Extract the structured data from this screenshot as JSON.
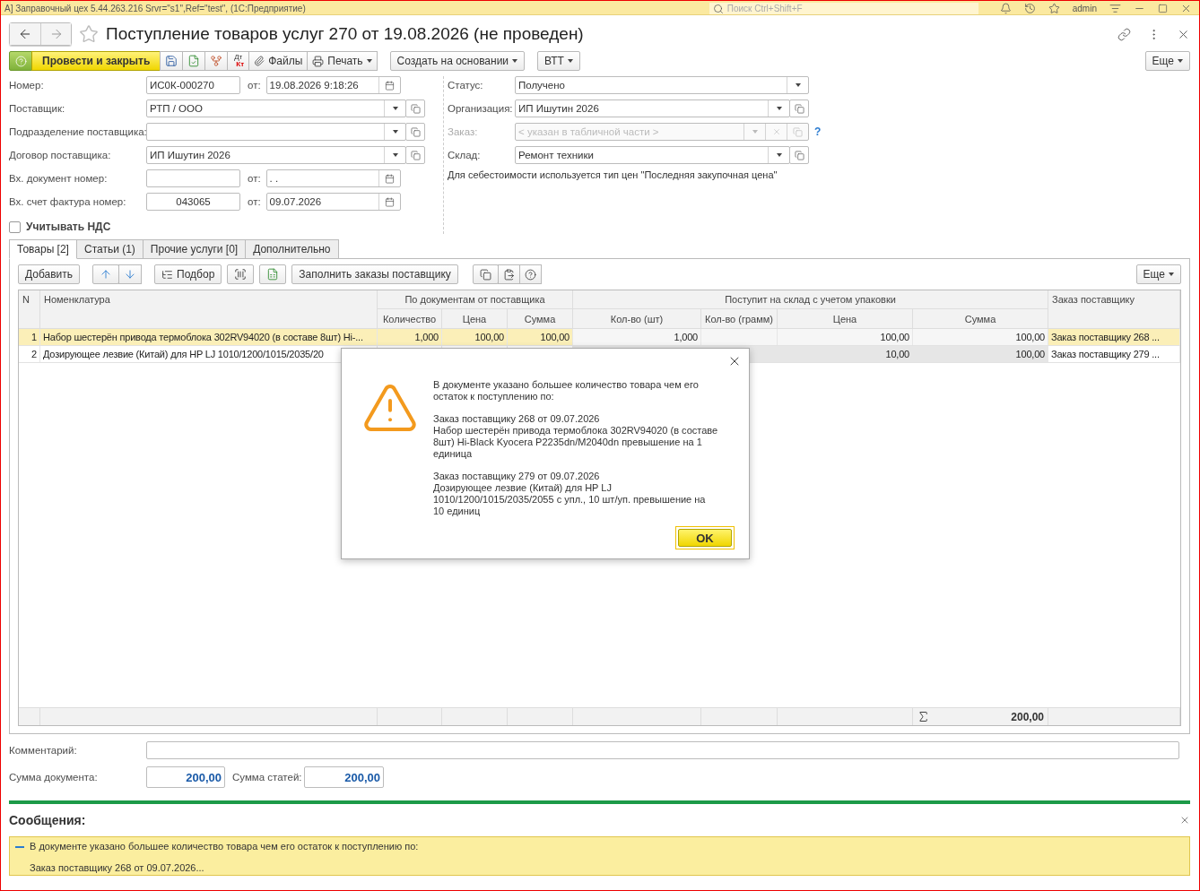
{
  "app_bar": {
    "title": "А] Заправочный цех 5.44.263.216 Srvr=\"s1\",Ref=\"test\", (1С:Предприятие)",
    "search_placeholder": "Поиск Ctrl+Shift+F",
    "user": "admin"
  },
  "form": {
    "title": "Поступление товаров услуг 270 от 19.08.2026 (не проведен)"
  },
  "toolbar": {
    "primary": "Провести и закрыть",
    "ledger_marks": [
      "Дт",
      "Кт"
    ],
    "files": "Файлы",
    "print": "Печать",
    "create_based": "Создать на основании",
    "vtt": "ВТТ",
    "more": "Еще"
  },
  "left_fields": [
    {
      "kind": "number_date",
      "label": "Номер:",
      "value": "ИС0К-000270",
      "date_label": "от:",
      "date": "19.08.2026  9:18:26"
    },
    {
      "kind": "select",
      "label": "Поставщик:",
      "value": "РТП / ООО"
    },
    {
      "kind": "select",
      "label": "Подразделение поставщика:"
    },
    {
      "kind": "select",
      "label": "Договор поставщика:",
      "value": "ИП Ишутин 2026"
    },
    {
      "kind": "number_date",
      "label": "Вх. документ номер:",
      "date_label": "от:",
      "date": " .  ."
    },
    {
      "kind": "number_date",
      "label": "Вх. счет фактура номер:",
      "value": "043065",
      "centered": true,
      "date_label": "от:",
      "date": "09.07.2026"
    }
  ],
  "vat_checkbox": {
    "label": "Учитывать НДС",
    "checked": false
  },
  "right_fields": [
    {
      "kind": "status",
      "label": "Статус:",
      "value": "Получено"
    },
    {
      "kind": "select",
      "label": "Организация:",
      "value": "ИП Ишутин 2026"
    },
    {
      "kind": "disabled",
      "label": "Заказ:",
      "placeholder": "< указан в табличной части >",
      "help": "?"
    },
    {
      "kind": "select",
      "label": "Склад:",
      "value": "Ремонт техники"
    }
  ],
  "cost_note": "Для себестоимости используется тип цен \"Последняя закупочная цена\"",
  "tabs": [
    {
      "label": "Товары [2]",
      "selected": true
    },
    {
      "label": "Статьи (1)",
      "selected": false
    },
    {
      "label": "Прочие услуги [0]",
      "selected": false
    },
    {
      "label": "Дополнительно",
      "selected": false
    }
  ],
  "table_toolbar": {
    "add": "Добавить",
    "pick": "Подбор",
    "fill_orders": "Заполнить заказы поставщику",
    "more": "Еще"
  },
  "table": {
    "groups": [
      "По документам от поставщика",
      "Поступит на склад с учетом упаковки"
    ],
    "columns": [
      "N",
      "Номенклатура",
      "Количество",
      "Цена",
      "Сумма",
      "Кол-во (шт)",
      "Кол-во (грамм)",
      "Цена",
      "Сумма",
      "Заказ поставщику"
    ],
    "rows": [
      {
        "selected": true,
        "cells": [
          "1",
          "Набор шестерён привода термоблока 302RV94020 (в составе 8шт) Hi-...",
          "1,000",
          "100,00",
          "100,00",
          "1,000",
          null,
          "100,00",
          "100,00",
          "Заказ поставщику 268 ..."
        ]
      },
      {
        "selected": false,
        "cells": [
          "2",
          "Дозирующее лезвие (Китай) для HP LJ 1010/1200/1015/2035/20",
          null,
          null,
          null,
          null,
          null,
          "10,00",
          "100,00",
          "Заказ поставщику 279 ..."
        ]
      }
    ],
    "total": "200,00"
  },
  "comment": {
    "label": "Комментарий:"
  },
  "doc_sum": {
    "label": "Сумма документа:",
    "value": "200,00"
  },
  "items_sum": {
    "label": "Сумма статей:",
    "value": "200,00"
  },
  "messages": {
    "title": "Сообщения:",
    "lines": [
      "В документе указано большее количество товара чем его остаток к поступлению по:",
      "Заказ поставщику 268 от 09.07.2026..."
    ]
  },
  "dialog": {
    "paragraphs": [
      [
        "В документе указано большее количество товара чем его остаток к поступлению по:"
      ],
      [
        "Заказ поставщику 268 от 09.07.2026",
        "Набор шестерён привода термоблока 302RV94020 (в составе 8шт) Hi-Black Kyocera P2235dn/M2040dn превышение на 1 единица"
      ],
      [
        "Заказ поставщику 279 от 09.07.2026",
        "Дозирующее лезвие (Китай) для HP LJ 1010/1200/1015/2035/2055  с упл., 10 шт/уп. превышение на 10 единиц"
      ]
    ],
    "ok": "OK"
  }
}
